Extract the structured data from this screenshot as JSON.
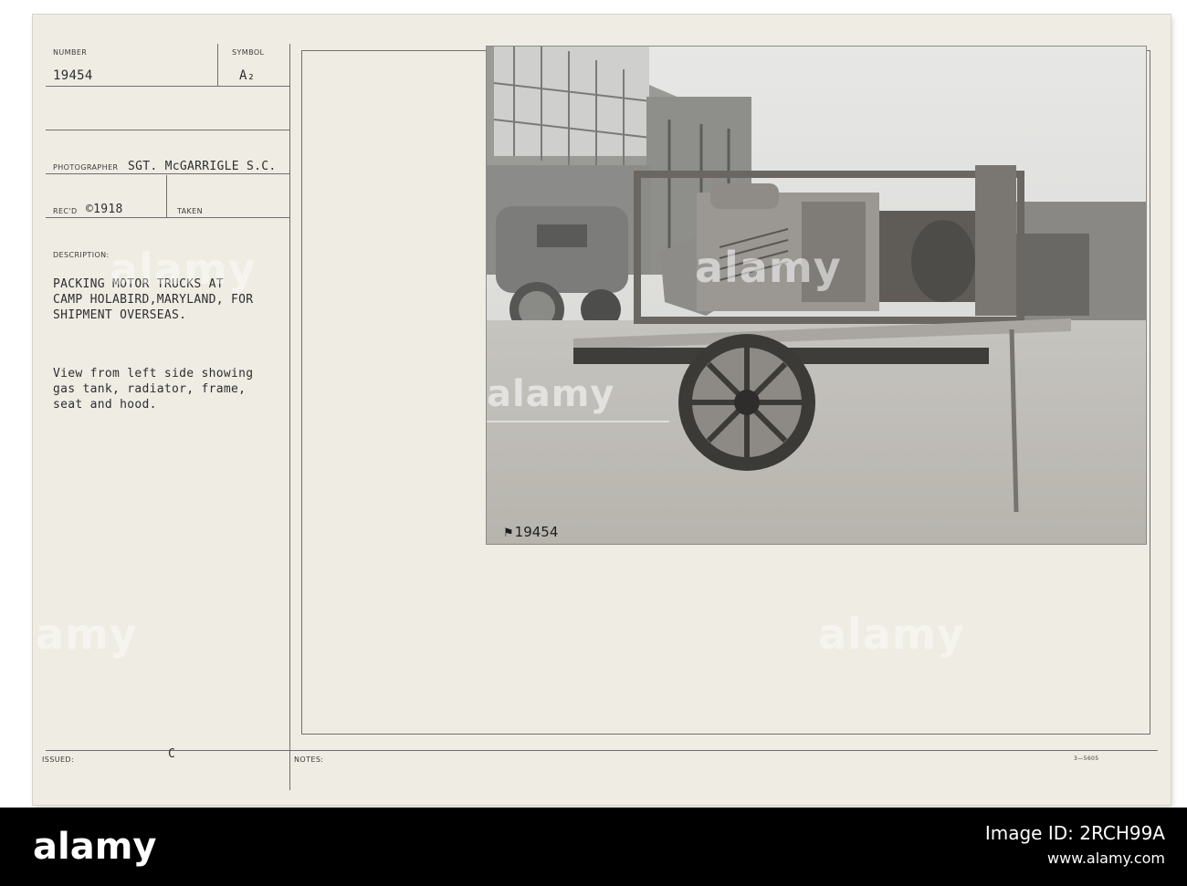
{
  "card": {
    "number_label": "NUMBER",
    "number_value": "19454",
    "symbol_label": "SYMBOL",
    "symbol_value": "A₂",
    "photographer_label": "PHOTOGRAPHER",
    "photographer_value": "SGT. McGARRIGLE S.C.",
    "recd_label": "REC'D",
    "recd_value": "©1918",
    "taken_label": "TAKEN",
    "description_label": "DESCRIPTION:",
    "description_title_lines": [
      "PACKING MOTOR TRUCKS AT",
      "CAMP HOLABIRD,MARYLAND, FOR",
      "SHIPMENT OVERSEAS."
    ],
    "description_detail_lines": [
      "View from left side showing",
      "gas tank, radiator, frame,",
      "seat and hood."
    ],
    "issued_label": "ISSUED:",
    "issued_value": "C",
    "notes_label": "NOTES:",
    "form_number": "3—5605"
  },
  "photo": {
    "negative_number": "19454",
    "subject": "wooden crate frame holding truck hood and radiator on spoked-wheel trailer"
  },
  "watermark": {
    "brand": "alamy"
  },
  "footer": {
    "logo": "alamy",
    "image_id_label": "Image ID: 2RCH99A",
    "site": "www.alamy.com"
  }
}
